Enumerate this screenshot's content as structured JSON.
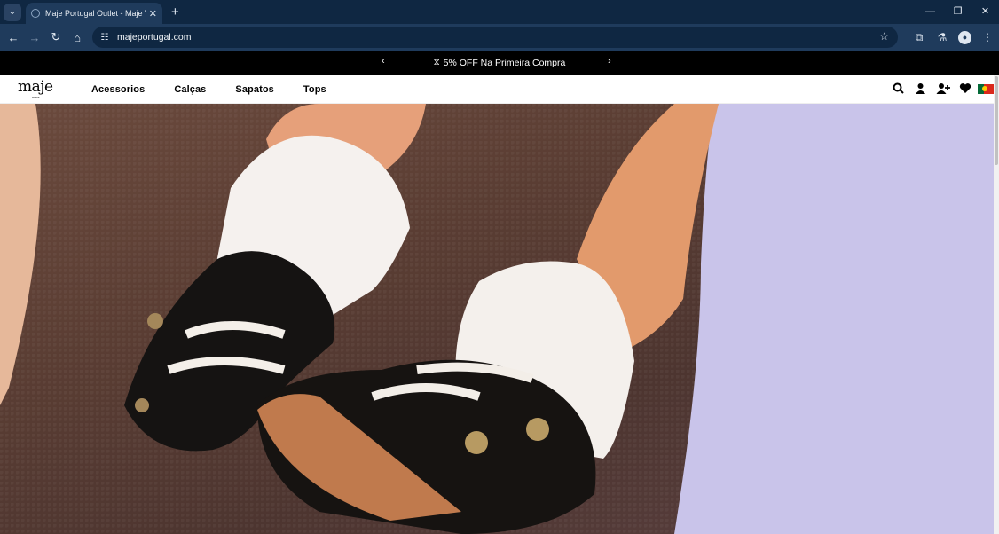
{
  "browser": {
    "tab_title": "Maje Portugal Outlet - Maje Ve",
    "url": "majeportugal.com"
  },
  "promo": {
    "text": "5% OFF Na Primeira Compra",
    "prev_glyph": "‹",
    "next_glyph": "›"
  },
  "site": {
    "logo": "maje",
    "logo_sub": "PARIS",
    "menu": [
      {
        "label": "Acessorios"
      },
      {
        "label": "Calças"
      },
      {
        "label": "Sapatos"
      },
      {
        "label": "Tops"
      }
    ]
  },
  "colors": {
    "chrome_dark": "#0f2742",
    "chrome_toolbar": "#1f3b5c",
    "promo_bg": "#000000"
  }
}
